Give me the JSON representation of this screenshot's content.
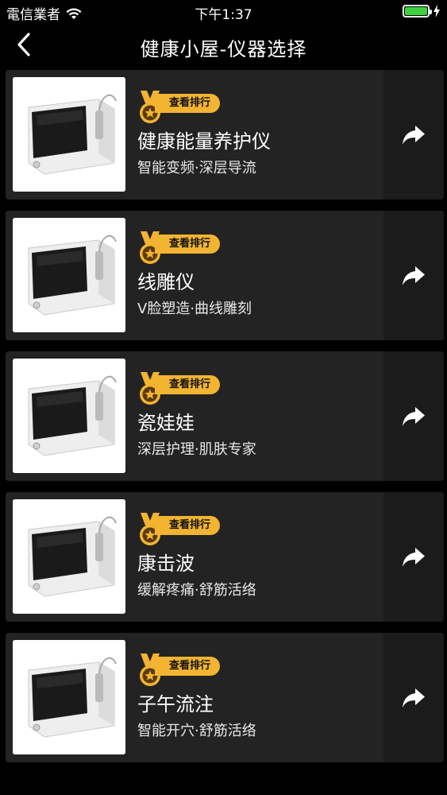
{
  "status_bar": {
    "carrier": "電信業者",
    "time": "下午1:37",
    "battery_level": 1.0,
    "wifi_icon": "wifi-icon",
    "battery_icon": "battery-icon",
    "charging_icon": "charging-bolt-icon"
  },
  "nav": {
    "title": "健康小屋-仪器选择",
    "back_icon": "chevron-left-icon"
  },
  "colors": {
    "background": "#000000",
    "card": "#232323",
    "share_cell": "#1b1b1b",
    "badge": "#f2b431",
    "battery": "#3ed23e"
  },
  "devices": [
    {
      "badge": "查看排行",
      "name": "健康能量养护仪",
      "tagline": "智能变频·深层导流",
      "image_icon": "device-image"
    },
    {
      "badge": "查看排行",
      "name": "线雕仪",
      "tagline": "V脸塑造·曲线雕刻",
      "image_icon": "device-image"
    },
    {
      "badge": "查看排行",
      "name": "瓷娃娃",
      "tagline": "深层护理·肌肤专家",
      "image_icon": "device-image"
    },
    {
      "badge": "查看排行",
      "name": "康击波",
      "tagline": "缓解疼痛·舒筋活络",
      "image_icon": "device-image"
    },
    {
      "badge": "查看排行",
      "name": "子午流注",
      "tagline": "智能开穴·舒筋活络",
      "image_icon": "device-image"
    }
  ]
}
